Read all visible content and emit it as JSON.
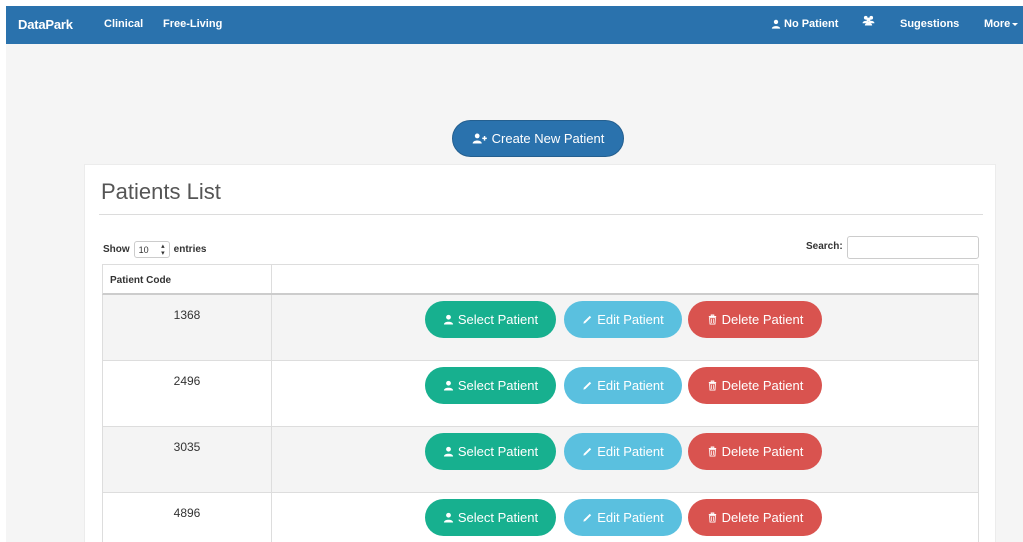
{
  "navbar": {
    "brand": "DataPark",
    "links": {
      "clinical": "Clinical",
      "free_living": "Free-Living"
    },
    "no_patient": "No Patient",
    "sugestions": "Sugestions",
    "more": "More"
  },
  "create_button": "Create New Patient",
  "panel": {
    "title": "Patients List",
    "show": "Show",
    "entries_value": "10",
    "entries": "entries",
    "search": "Search:"
  },
  "table": {
    "headers": {
      "code": "Patient Code"
    },
    "rows": [
      {
        "code": "1368"
      },
      {
        "code": "2496"
      },
      {
        "code": "3035"
      },
      {
        "code": "4896"
      }
    ]
  },
  "actions": {
    "select": "Select Patient",
    "edit": "Edit Patient",
    "delete": "Delete Patient"
  },
  "colors": {
    "navbar": "#2a72ad",
    "select": "#17b08f",
    "edit": "#5ac0df",
    "delete": "#d9534f"
  },
  "icons": {
    "no_patient": "user-icon",
    "group": "users-icon",
    "create": "user-plus-icon",
    "select": "user-icon",
    "edit": "pencil-icon",
    "delete": "trash-icon"
  }
}
